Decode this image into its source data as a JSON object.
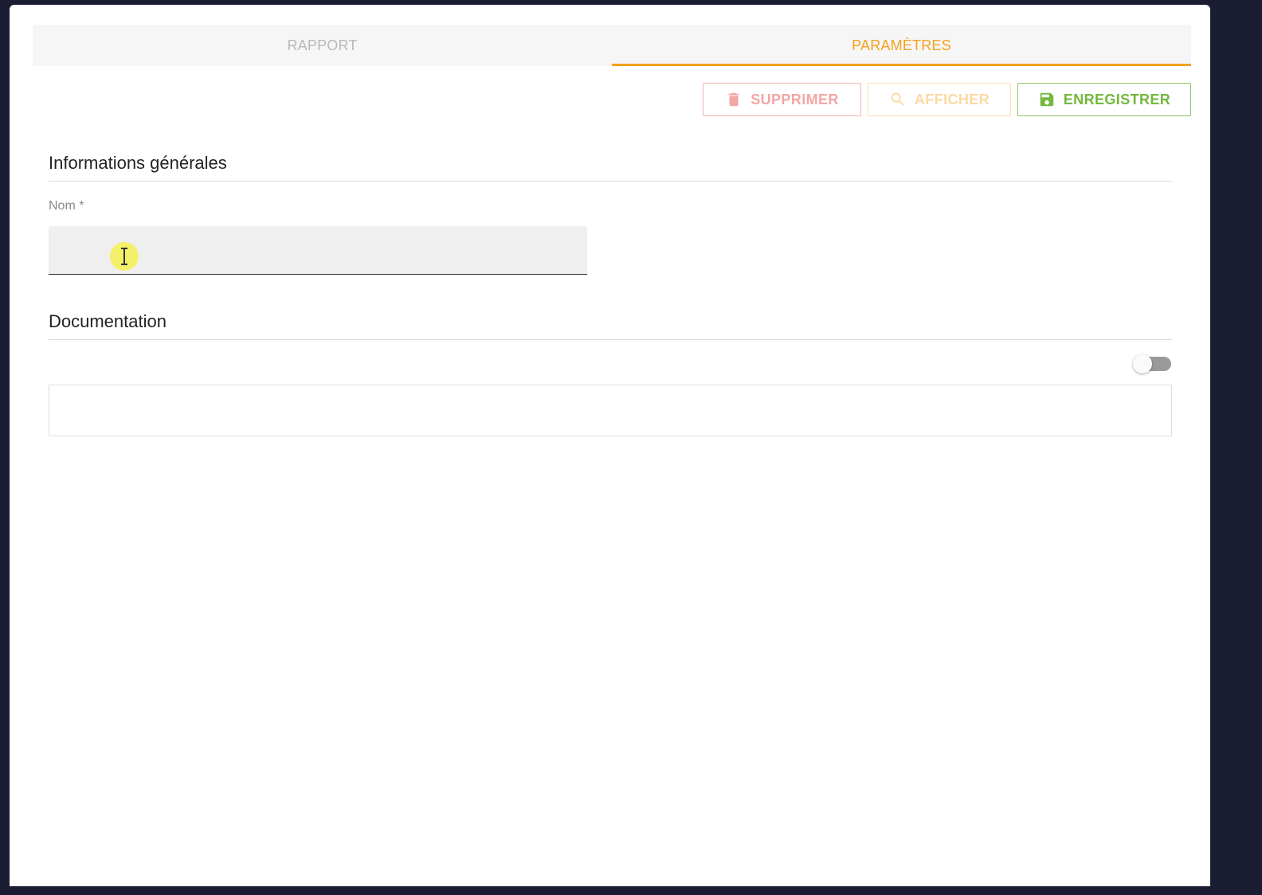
{
  "tabs": [
    {
      "label": "RAPPORT",
      "active": false
    },
    {
      "label": "PARAMÈTRES",
      "active": true
    }
  ],
  "toolbar": {
    "delete_label": "SUPPRIMER",
    "show_label": "AFFICHER",
    "save_label": "ENREGISTRER"
  },
  "general_info": {
    "title": "Informations générales",
    "name_label": "Nom *",
    "name_value": ""
  },
  "documentation": {
    "title": "Documentation",
    "toggle_on": false,
    "content": ""
  },
  "colors": {
    "accent": "#f5a21e",
    "delete": "#f3a6a6",
    "show": "#fbd9a0",
    "save": "#74b83c",
    "background": "#1b1d33"
  },
  "icons": {
    "delete": "trash-icon",
    "show": "search-icon",
    "save": "floppy-disk-icon",
    "cursor": "text-cursor-icon"
  }
}
